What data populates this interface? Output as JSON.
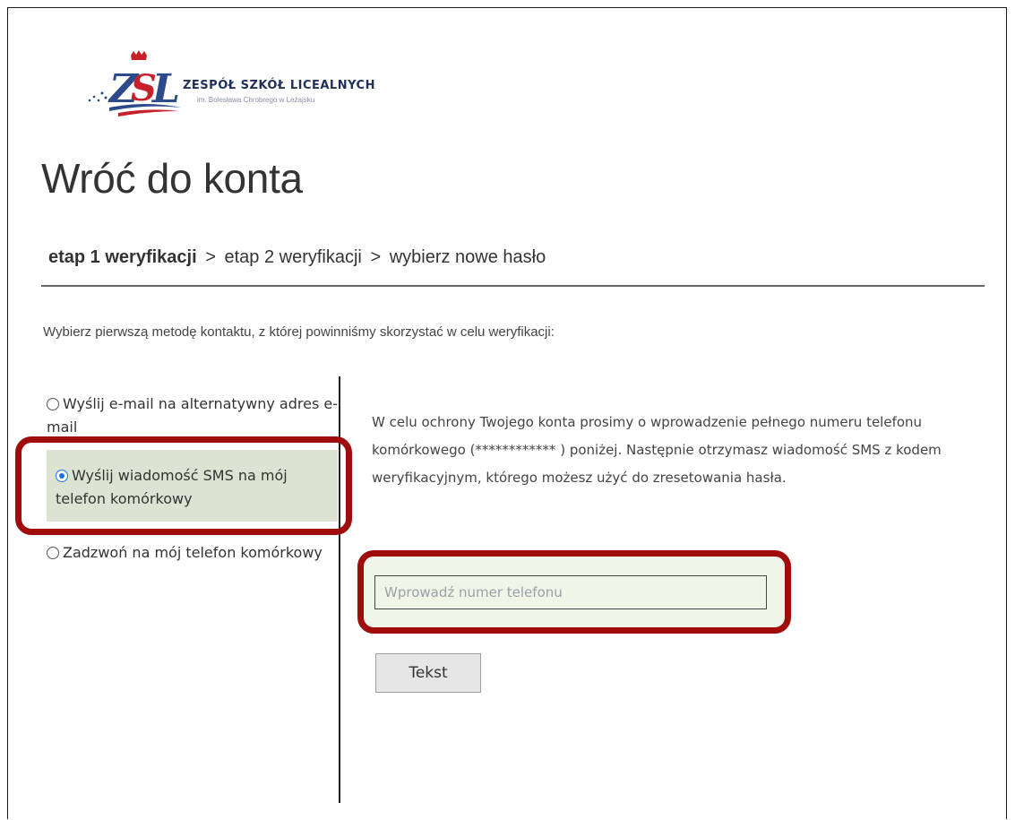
{
  "logo": {
    "title": "ZESPÓŁ SZKÓŁ LICEALNYCH",
    "subtitle": "im. Bolesława Chrobrego w Leżajsku",
    "mark": "ZSL"
  },
  "page_title": "Wróć do konta",
  "breadcrumb": {
    "step1": "etap 1 weryfikacji",
    "sep": ">",
    "step2": "etap 2 weryfikacji",
    "step3": "wybierz nowe hasło"
  },
  "instruction": "Wybierz pierwszą metodę kontaktu, z której powinniśmy skorzystać w celu weryfikacji:",
  "options": [
    {
      "label": "Wyślij e-mail na alternatywny adres e-mail",
      "selected": false
    },
    {
      "label": "Wyślij wiadomość SMS na mój telefon komórkowy",
      "selected": true
    },
    {
      "label": "Zadzwoń na mój telefon komórkowy",
      "selected": false
    }
  ],
  "description": "W celu ochrony Twojego konta prosimy o wprowadzenie pełnego numeru telefonu komórkowego (************ ) poniżej. Następnie otrzymasz wiadomość SMS z kodem weryfikacyjnym, którego możesz użyć do zresetowania hasła.",
  "phone_input": {
    "placeholder": "Wprowadź numer telefonu",
    "value": ""
  },
  "submit_label": "Tekst",
  "colors": {
    "highlight": "#a00c0c",
    "selected_bg": "#dde3d3",
    "radio": "#1a73e8"
  }
}
